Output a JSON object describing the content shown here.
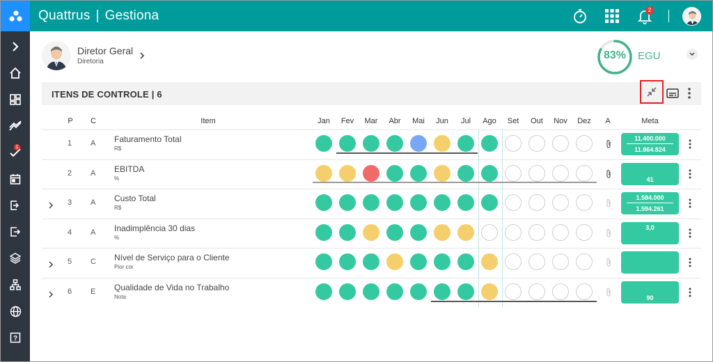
{
  "app": {
    "brand": "Quattrus",
    "module": "Gestiona"
  },
  "topbar": {
    "icons": [
      "stopwatch-icon",
      "apps-grid-icon",
      "bell-icon",
      "user-avatar"
    ],
    "notification_count": "2"
  },
  "sidebar": {
    "items": [
      "expand-chevron-icon",
      "home-icon",
      "dashboard-icon",
      "trend-icon",
      "checklist-icon",
      "calendar-icon",
      "login-icon",
      "logout-icon",
      "layers-icon",
      "org-chart-icon",
      "globe-icon",
      "help-icon"
    ],
    "checklist_badge": "1"
  },
  "user": {
    "name": "Diretor Geral",
    "department": "Diretoria"
  },
  "egu": {
    "percent_label": "83%",
    "value": 0.83,
    "label": "EGU"
  },
  "section": {
    "title": "ITENS DE CONTROLE | 6"
  },
  "colors": {
    "green": "#34c9a0",
    "yellow": "#f5cf6b",
    "red": "#f06a6a",
    "blue": "#7aa7f5",
    "teal": "#009b9b"
  },
  "table": {
    "headers": {
      "p": "P",
      "c": "C",
      "item": "Item",
      "a": "A",
      "meta": "Meta"
    },
    "months": [
      "Jan",
      "Fev",
      "Mar",
      "Abr",
      "Mai",
      "Jun",
      "Jul",
      "Ago",
      "Set",
      "Out",
      "Nov",
      "Dez"
    ],
    "rows": [
      {
        "p": "1",
        "c": "A",
        "title": "Faturamento Total",
        "unit": "R$",
        "expandable": false,
        "status": [
          "green",
          "green",
          "green",
          "green",
          "blue",
          "yellow",
          "green",
          "green",
          "empty",
          "empty",
          "empty",
          "empty"
        ],
        "meta1": "11.400.000",
        "meta2": "11.864.824"
      },
      {
        "p": "2",
        "c": "A",
        "title": "EBITDA",
        "unit": "%",
        "expandable": false,
        "status": [
          "yellow",
          "yellow",
          "red",
          "green",
          "green",
          "yellow",
          "green",
          "green",
          "empty",
          "empty",
          "empty",
          "empty"
        ],
        "meta1": "",
        "meta2": "41"
      },
      {
        "p": "3",
        "c": "A",
        "title": "Custo Total",
        "unit": "R$",
        "expandable": true,
        "status": [
          "green",
          "green",
          "green",
          "green",
          "green",
          "green",
          "green",
          "green",
          "empty",
          "empty",
          "empty",
          "empty"
        ],
        "meta1": "1.584.000",
        "meta2": "1.594.261"
      },
      {
        "p": "4",
        "c": "A",
        "title": "Inadimplência 30 dias",
        "unit": "%",
        "expandable": false,
        "status": [
          "green",
          "green",
          "yellow",
          "green",
          "green",
          "yellow",
          "yellow",
          "empty",
          "empty",
          "empty",
          "empty",
          "empty"
        ],
        "meta1": "3,0",
        "meta2": ""
      },
      {
        "p": "5",
        "c": "C",
        "title": "Nível de Serviço para o Cliente",
        "unit": "Pior cor",
        "expandable": true,
        "status": [
          "green",
          "green",
          "green",
          "yellow",
          "green",
          "green",
          "green",
          "yellow",
          "empty",
          "empty",
          "empty",
          "empty"
        ],
        "meta1": "",
        "meta2": ""
      },
      {
        "p": "6",
        "c": "E",
        "title": "Qualidade de Vida no Trabalho",
        "unit": "Nota",
        "expandable": true,
        "status": [
          "green",
          "green",
          "green",
          "green",
          "green",
          "green",
          "green",
          "yellow",
          "empty",
          "empty",
          "empty",
          "empty"
        ],
        "meta1": "",
        "meta2": "90"
      }
    ]
  }
}
